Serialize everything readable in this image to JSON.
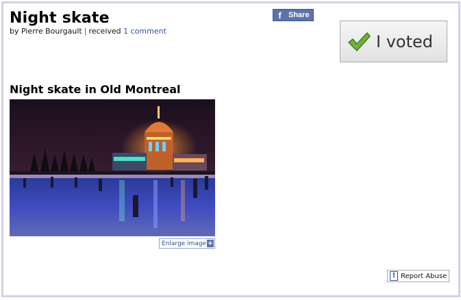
{
  "post": {
    "title": "Night skate",
    "byline": {
      "prefix": "by Pierre Bourgault",
      "separator": "|",
      "received": "received",
      "comments_link": "1 comment"
    },
    "subtitle": "Night skate in Old Montreal"
  },
  "share": {
    "label": "Share",
    "icon": "facebook-icon"
  },
  "vote": {
    "label": "I voted",
    "icon": "checkmark-icon"
  },
  "image": {
    "enlarge_label": "Enlarge image",
    "enlarge_icon": "plus-icon"
  },
  "report": {
    "label": "Report Abuse",
    "icon": "exclamation-icon"
  },
  "colors": {
    "link": "#2d4f9e",
    "facebook": "#3b5998",
    "frame": "#d4d0e8"
  }
}
